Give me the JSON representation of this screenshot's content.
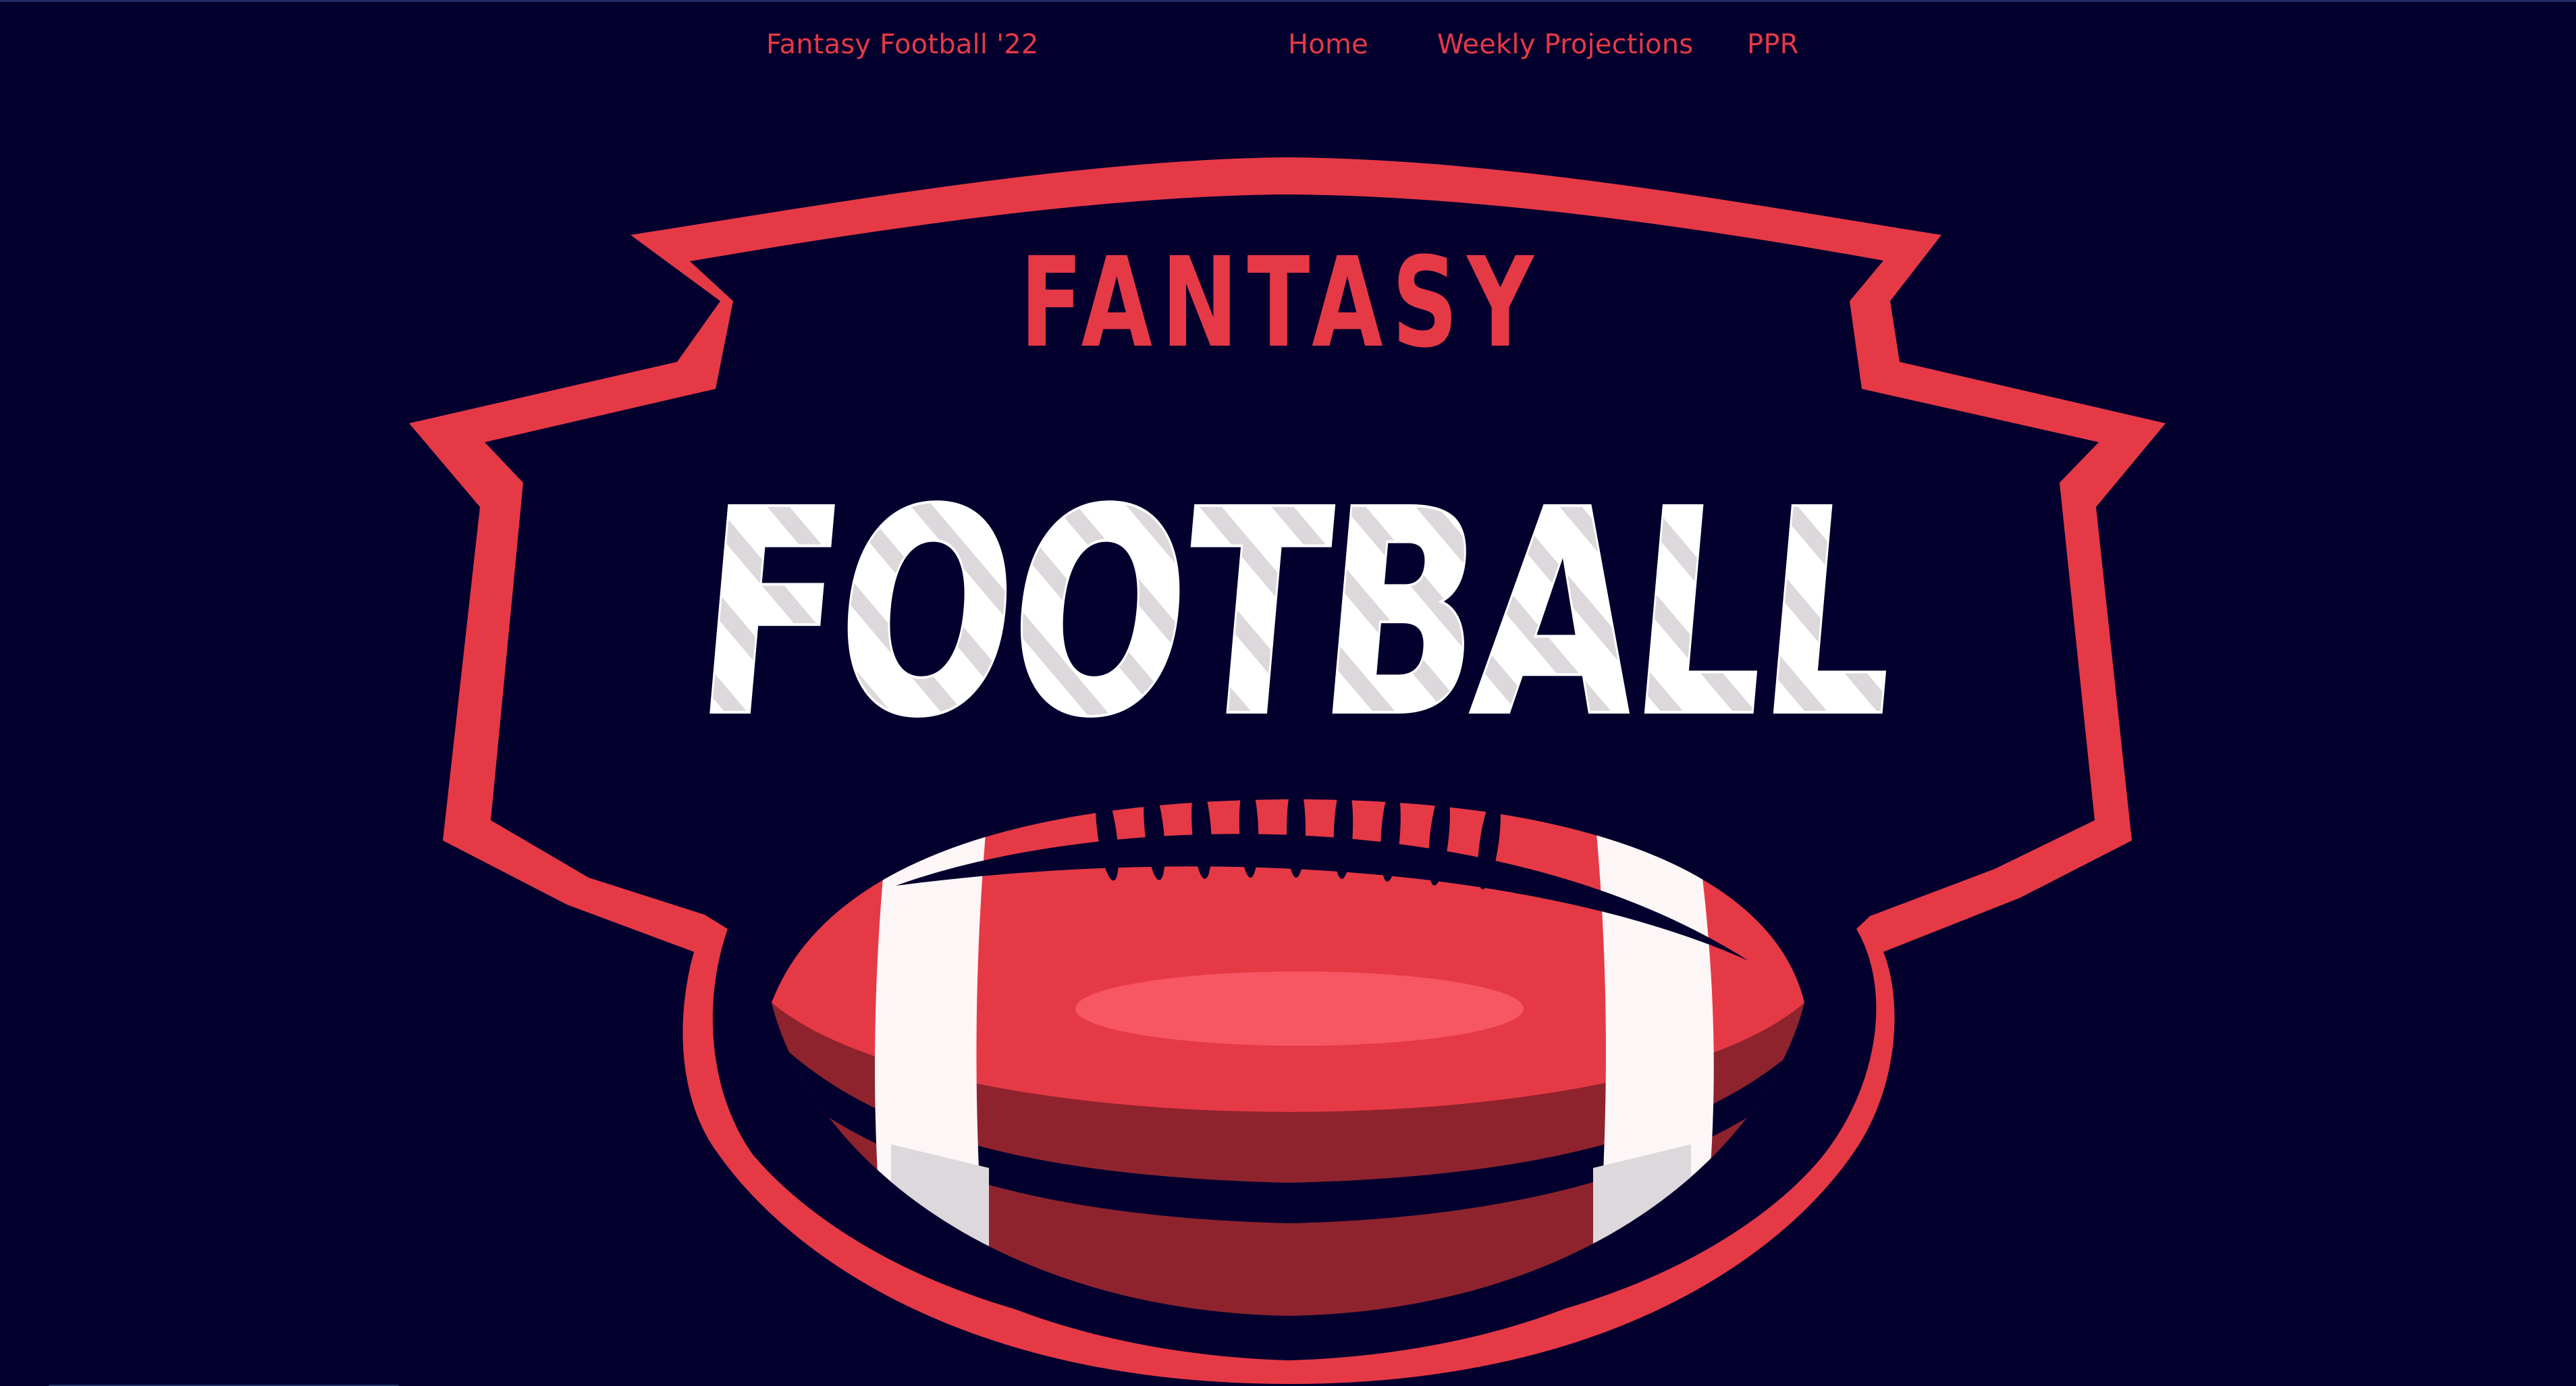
{
  "header": {
    "site_title": "Fantasy Football '22",
    "nav": [
      {
        "label": "Home"
      },
      {
        "label": "Weekly Projections"
      },
      {
        "label": "PPR"
      }
    ]
  },
  "hero": {
    "logo_word_top": "FANTASY",
    "logo_word_main": "FOOTBALL",
    "logo_icon": "american-football-icon"
  },
  "colors": {
    "background": "#03002e",
    "accent": "#e63946",
    "logo_white": "#ffffff",
    "logo_gray": "#dcd8dc",
    "ball_light": "#f75663",
    "ball_dark": "#8f232d"
  }
}
